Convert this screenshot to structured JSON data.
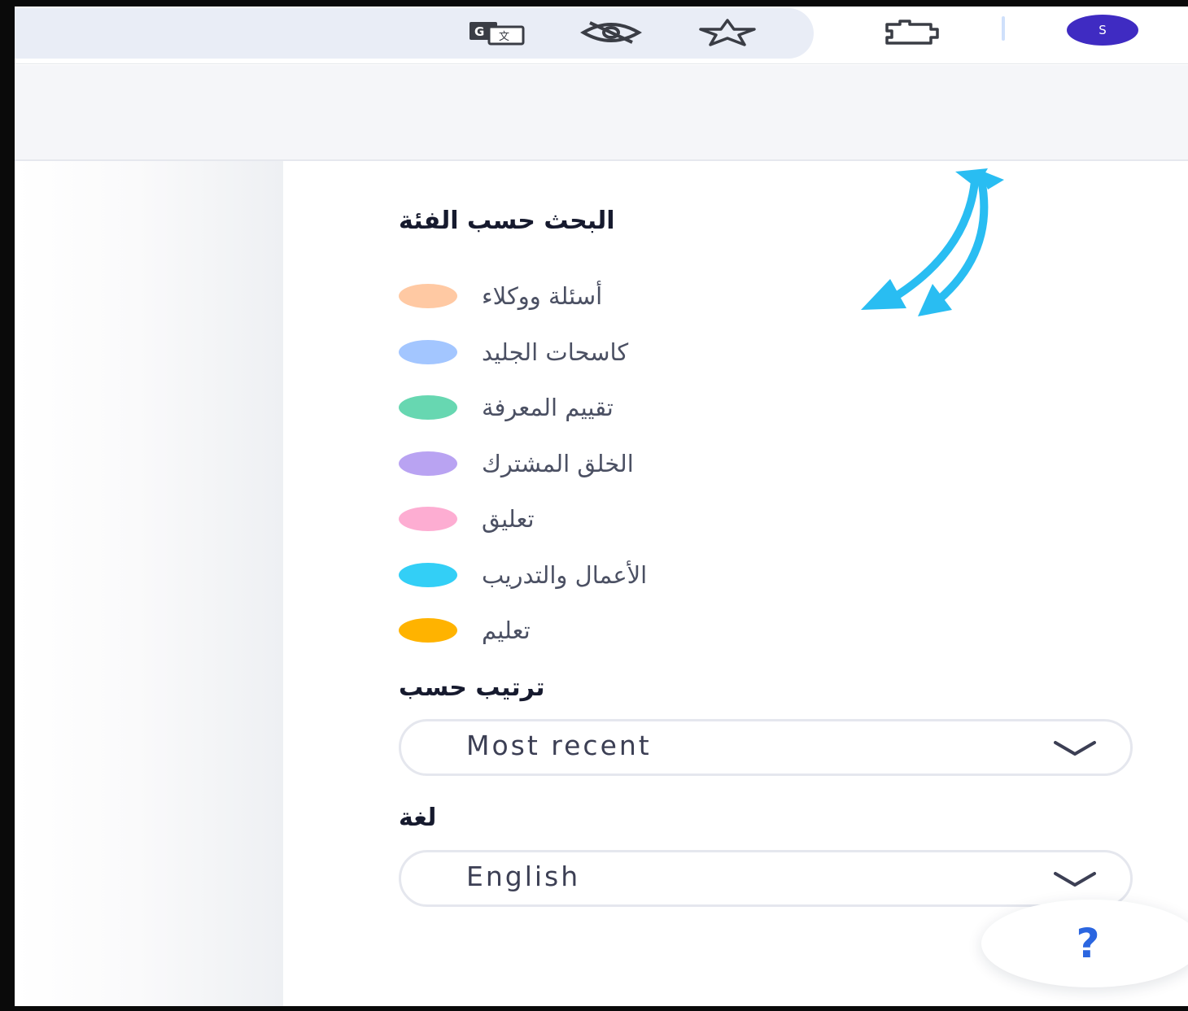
{
  "toolbar": {
    "icons": [
      "translate-icon",
      "eye-off-icon",
      "star-icon",
      "extensions-icon"
    ],
    "avatar_initial": "S"
  },
  "filters": {
    "category_title": "البحث حسب الفئة",
    "categories": [
      {
        "label": "أسئلة ووكلاء",
        "color": "#ffc9a3"
      },
      {
        "label": "كاسحات الجليد",
        "color": "#a3c6ff"
      },
      {
        "label": "تقييم المعرفة",
        "color": "#67d7b1"
      },
      {
        "label": "الخلق المشترك",
        "color": "#b9a3f2"
      },
      {
        "label": "تعليق",
        "color": "#fdadd2"
      },
      {
        "label": "الأعمال والتدريب",
        "color": "#33cff6"
      },
      {
        "label": "تعليم",
        "color": "#ffb300"
      }
    ],
    "sort_title": "ترتيب حسب",
    "sort_value": "Most recent",
    "language_title": "لغة",
    "language_value": "English"
  },
  "help": {
    "glyph": "?"
  },
  "colors": {
    "avatar": "#3f2bc2",
    "omnibox": "#e9edf6",
    "help_accent": "#2b66e0",
    "arrow_accent": "#29bdf2"
  }
}
